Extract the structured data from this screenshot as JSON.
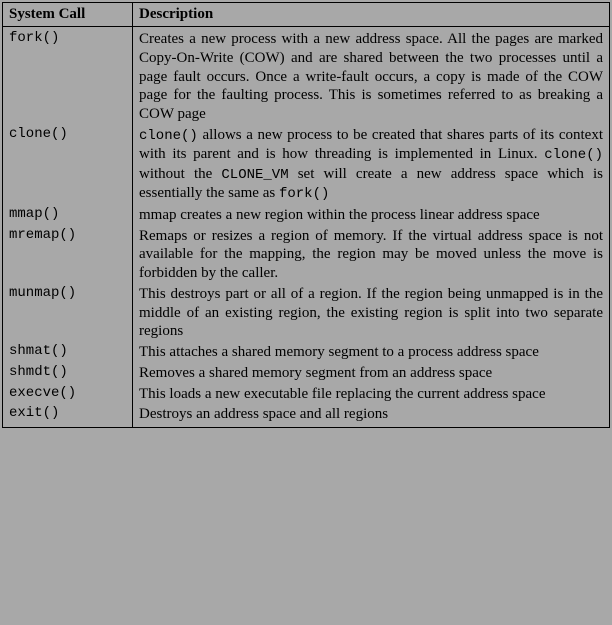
{
  "headers": {
    "col1": "System Call",
    "col2": "Description"
  },
  "rows": [
    {
      "call": "fork()",
      "desc_pre": "Creates a new process with a new address space. All the pages are marked Copy-On-Write (COW) and are shared between the two processes until a page fault occurs. Once a write-fault occurs, a copy is made of the COW page for the faulting process. This is sometimes referred to as breaking a COW page"
    },
    {
      "call": "clone()",
      "desc_parts": {
        "p1": "clone()",
        "p2": " allows a new process to be created that shares parts of its context with its parent and is how threading is implemented in Linux. ",
        "p3": "clone()",
        "p4": " without the ",
        "p5": "CLONE_VM",
        "p6": " set will create a new address space which is essentially the same as ",
        "p7": "fork()"
      }
    },
    {
      "call": "mmap()",
      "desc_pre": "mmap creates a new region within the process linear address space"
    },
    {
      "call": "mremap()",
      "desc_pre": "Remaps or resizes a region of memory. If the virtual address space is not available for the mapping, the region may be moved unless the move is forbidden by the caller."
    },
    {
      "call": "munmap()",
      "desc_pre": "This destroys part or all of a region. If the region being unmapped is in the middle of an existing region, the existing region is split into two separate regions"
    },
    {
      "call": "shmat()",
      "desc_pre": "This attaches a shared memory segment to a process address space"
    },
    {
      "call": "shmdt()",
      "desc_pre": "Removes a shared memory segment from an address space"
    },
    {
      "call": "execve()",
      "desc_pre": "This loads a new executable file replacing the current address space"
    },
    {
      "call": "exit()",
      "desc_pre": "Destroys an address space and all regions"
    }
  ]
}
